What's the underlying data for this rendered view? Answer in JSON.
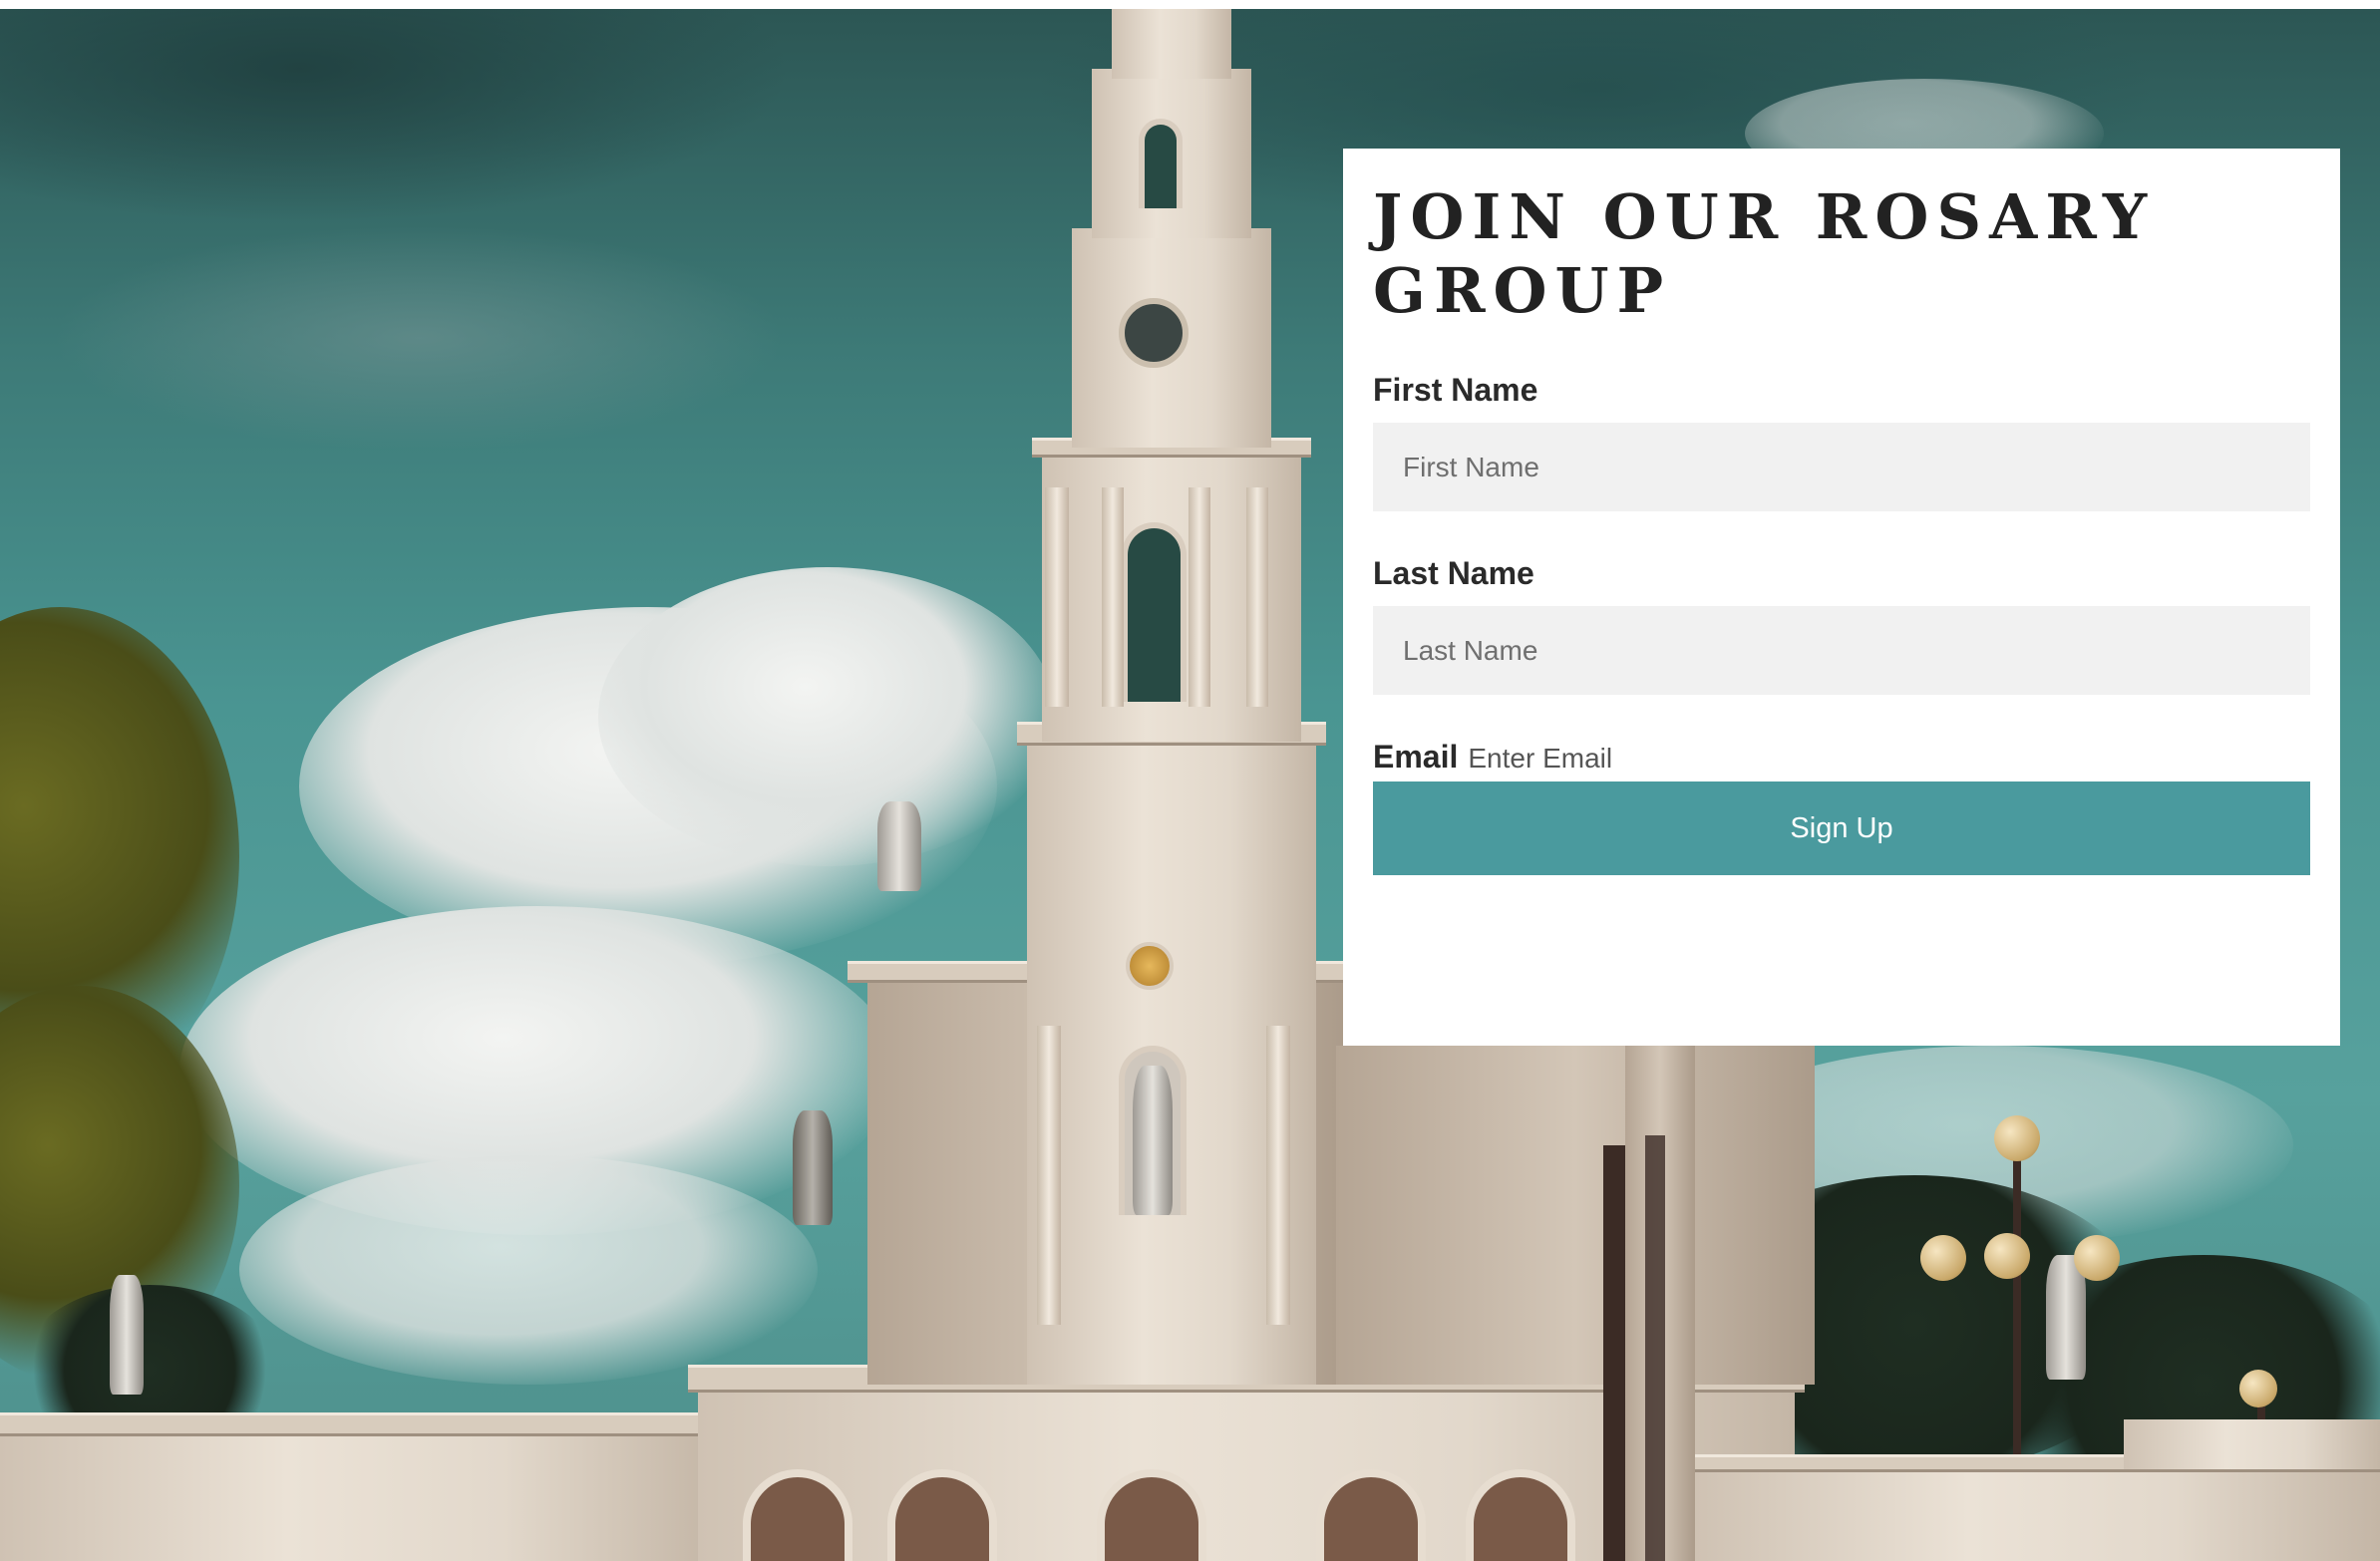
{
  "signup": {
    "title": "JOIN OUR ROSARY GROUP",
    "first_name": {
      "label": "First Name",
      "placeholder": "First Name",
      "value": ""
    },
    "last_name": {
      "label": "Last Name",
      "placeholder": "Last Name",
      "value": ""
    },
    "email": {
      "label": "Email",
      "placeholder": "Enter Email",
      "value": ""
    },
    "submit_label": "Sign Up"
  },
  "colors": {
    "accent": "#4a9a9e",
    "input_background": "#f1f1f1",
    "title_text": "#222222"
  }
}
